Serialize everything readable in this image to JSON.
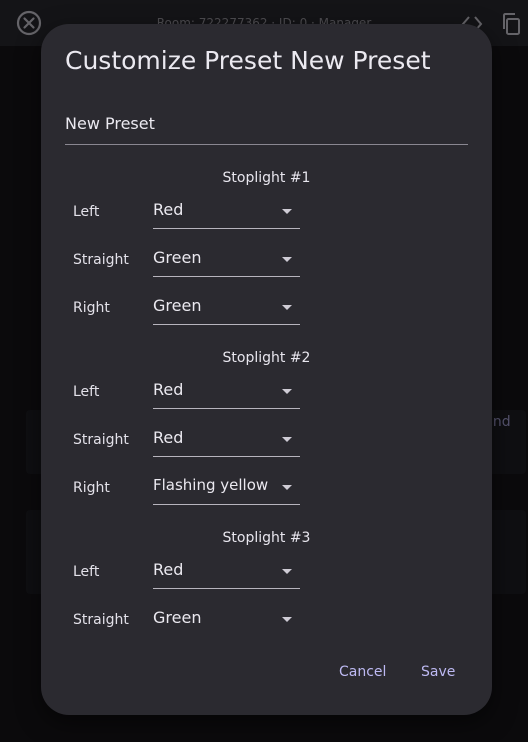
{
  "app": {
    "room_info": "Room: 722277362 · ID: 0 · Manager",
    "bg_card_text": "und"
  },
  "icons": {
    "close": "close-circle-icon",
    "code": "code-brackets-icon",
    "copy": "copy-icon",
    "dropdown": "dropdown-caret-icon"
  },
  "dialog": {
    "title": "Customize Preset New Preset",
    "name_value": "New Preset",
    "cancel_label": "Cancel",
    "save_label": "Save"
  },
  "stoplights": [
    {
      "title": "Stoplight #1",
      "rows": [
        {
          "label": "Left",
          "value": "Red"
        },
        {
          "label": "Straight",
          "value": "Green"
        },
        {
          "label": "Right",
          "value": "Green"
        }
      ]
    },
    {
      "title": "Stoplight #2",
      "rows": [
        {
          "label": "Left",
          "value": "Red"
        },
        {
          "label": "Straight",
          "value": "Red"
        },
        {
          "label": "Right",
          "value": "Flashing yellow"
        }
      ]
    },
    {
      "title": "Stoplight #3",
      "rows": [
        {
          "label": "Left",
          "value": "Red"
        },
        {
          "label": "Straight",
          "value": "Green"
        }
      ]
    }
  ],
  "colors": {
    "dialog_bg": "#2b2a30",
    "accent": "#bdb9f2",
    "text": "#ebe9f0"
  }
}
